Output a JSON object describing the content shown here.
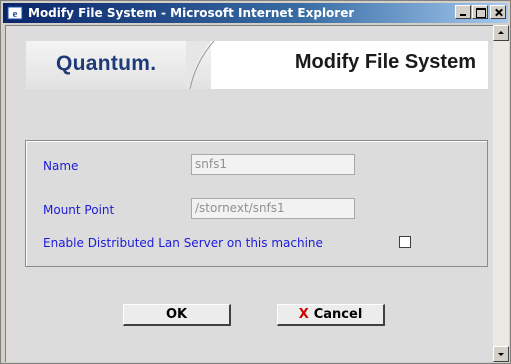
{
  "window": {
    "title": "Modify File System - Microsoft Internet Explorer",
    "controls": {
      "minimize": "minimize",
      "maximize": "maximize",
      "close": "close"
    }
  },
  "header": {
    "logo": "Quantum.",
    "title": "Modify File System"
  },
  "form": {
    "name_label": "Name",
    "name_value": "snfs1",
    "mount_label": "Mount Point",
    "mount_value": "/stornext/snfs1",
    "dls_label": "Enable Distributed Lan Server on this machine",
    "dls_checked": false
  },
  "buttons": {
    "ok_label": "OK",
    "cancel_label": "Cancel",
    "cancel_icon": "x-icon"
  },
  "colors": {
    "label_blue": "#1c1cd8",
    "logo_navy": "#1e3a78",
    "cancel_red": "#d40000",
    "titlebar_start": "#0a246a",
    "titlebar_end": "#a6caf0"
  }
}
